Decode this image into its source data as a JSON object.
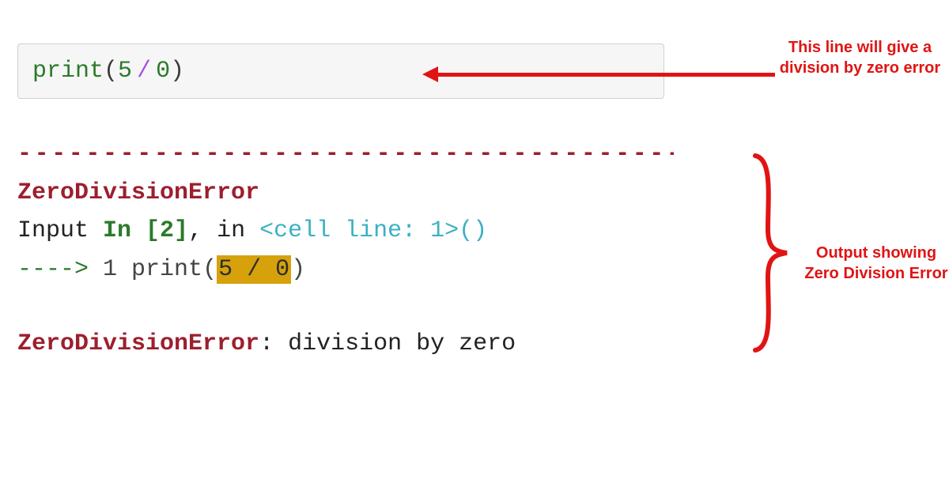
{
  "codecell": {
    "func": "print",
    "lparen": "(",
    "num1": "5",
    "op": "/",
    "num2": "0",
    "rparen": ")"
  },
  "annot": {
    "top": "This line will give a division by zero error",
    "bottom": "Output showing Zero Division Error"
  },
  "traceback": {
    "dashes": "---------------------------------------------",
    "err_name": "ZeroDivisionError",
    "input_prefix": "Input ",
    "in_kw": "In [2]",
    "comma_in": ", in ",
    "cell_ref": "<cell line: 1>",
    "paren_empty": "()",
    "arrow": "----> ",
    "lineno": "1",
    "call": " print(",
    "hl": "5 / 0",
    "call_close": ")",
    "final_name": "ZeroDivisionError",
    "final_colon": ": ",
    "final_msg": "division by zero"
  }
}
